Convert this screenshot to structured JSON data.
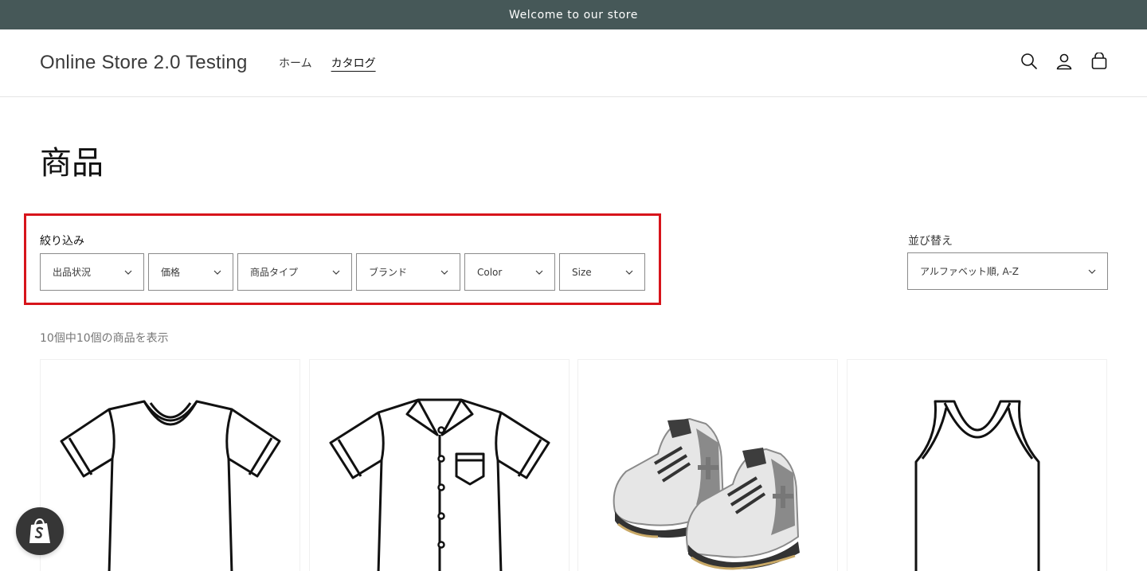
{
  "announcement": {
    "text": "Welcome to our store"
  },
  "header": {
    "logo": "Online Store 2.0 Testing",
    "nav": [
      {
        "label": "ホーム",
        "active": false
      },
      {
        "label": "カタログ",
        "active": true
      }
    ],
    "icons": [
      "search-icon",
      "account-icon",
      "cart-icon"
    ]
  },
  "page": {
    "title": "商品"
  },
  "filters": {
    "label": "絞り込み",
    "items": [
      {
        "label": "出品状況"
      },
      {
        "label": "価格"
      },
      {
        "label": "商品タイプ"
      },
      {
        "label": "ブランド"
      },
      {
        "label": "Color"
      },
      {
        "label": "Size"
      }
    ],
    "highlight_color": "#d7141b"
  },
  "sort": {
    "label": "並び替え",
    "selected": "アルファベット順, A-Z"
  },
  "product_count": "10個中10個の商品を表示",
  "products": [
    {
      "image": "v-neck-tshirt-icon"
    },
    {
      "image": "button-shirt-icon"
    },
    {
      "image": "sneakers-icon"
    },
    {
      "image": "tank-top-icon"
    }
  ],
  "colors": {
    "announcement_bg": "#465858",
    "text": "#121212",
    "muted_text": "#767676",
    "border": "#8a8a8a"
  }
}
